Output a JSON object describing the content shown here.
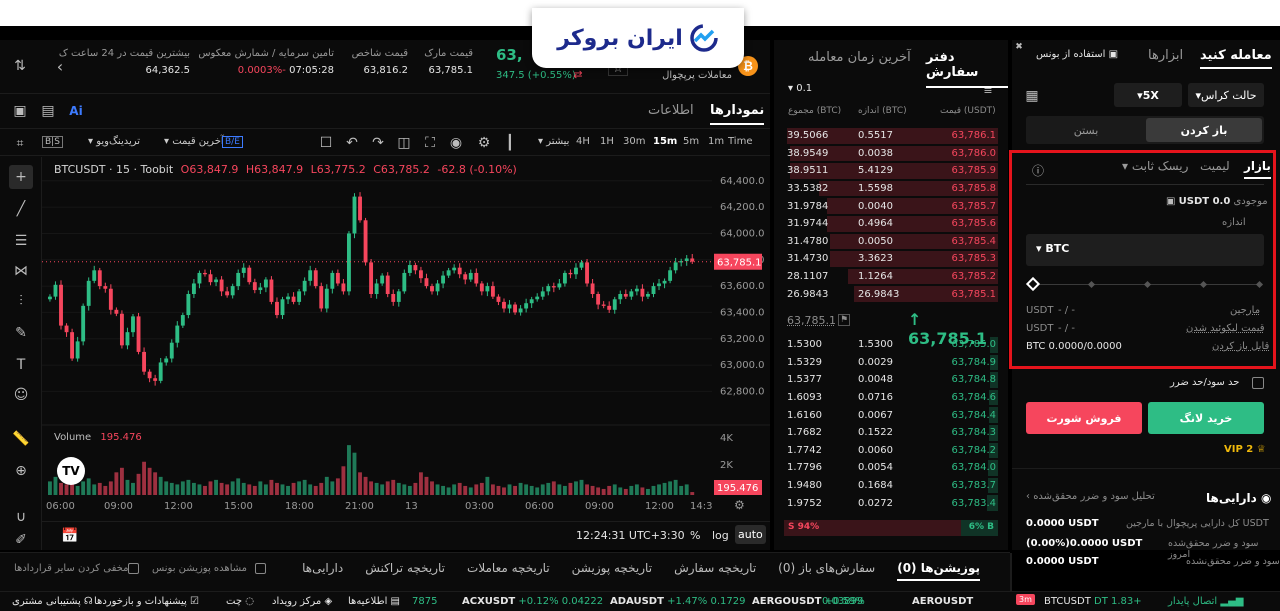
{
  "brand": {
    "logo_text": "ایران بروکر"
  },
  "header": {
    "symbol_price": "63,",
    "symbol_change": "347.5 (+0.55%)",
    "contract_type": "معاملات پرپچوال",
    "stats": [
      {
        "label": "قیمت مارک",
        "value": "63,785.1"
      },
      {
        "label": "قیمت شاخص",
        "value": "63,816.2"
      },
      {
        "label": "تامین سرمایه / شمارش معکوس",
        "value_red": "-0.0003%",
        "value": "07:05:28"
      },
      {
        "label": "بیشترین قیمت در 24 ساعت ک",
        "value": "64,362.5"
      }
    ]
  },
  "chart_tabs": {
    "charts": "نمودارها",
    "info": "اطلاعات"
  },
  "chart_toolbar": {
    "time": "Time",
    "intervals": [
      "1m",
      "5m",
      "15m",
      "30m",
      "1H",
      "4H"
    ],
    "active_interval": "15m",
    "more": "بیشتر",
    "last_price": "آخرین قیمت",
    "tradingview": "تریدینگ‌ویو",
    "be": "B/E",
    "bs": "B|S"
  },
  "chart_legend": {
    "symbol": "BTCUSDT · 15 · Toobit",
    "o": "O63,847.9",
    "h": "H63,847.9",
    "l": "L63,775.2",
    "c": "C63,785.2",
    "chg": "-62.8 (-0.10%)",
    "volume_label": "Volume",
    "volume_value": "195.476"
  },
  "chart_data": {
    "type": "candlestick",
    "symbol": "BTCUSDT",
    "interval": "15m",
    "ylim": [
      62560,
      64520
    ],
    "y_ticks": [
      "64,400.0",
      "64,200.0",
      "64,000.0",
      "63,800.0",
      "63,600.0",
      "63,400.0",
      "63,200.0",
      "63,000.0",
      "62,800.0"
    ],
    "last_price_tag": "63,785.1",
    "x_ticks": [
      "06:00",
      "09:00",
      "12:00",
      "15:00",
      "18:00",
      "21:00",
      "13",
      "03:00",
      "06:00",
      "09:00",
      "12:00",
      "14:3"
    ],
    "volume_ticks": [
      "4K",
      "2K"
    ],
    "volume_tag": "195.476",
    "close_series": [
      63520,
      63610,
      63300,
      63250,
      63050,
      63180,
      63450,
      63640,
      63720,
      63600,
      63580,
      63420,
      63390,
      63150,
      63250,
      63370,
      63100,
      62950,
      62900,
      62880,
      63020,
      63050,
      63170,
      63300,
      63380,
      63540,
      63620,
      63700,
      63690,
      63630,
      63650,
      63560,
      63530,
      63600,
      63700,
      63740,
      63630,
      63570,
      63590,
      63650,
      63480,
      63380,
      63500,
      63520,
      63480,
      63560,
      63640,
      63720,
      63600,
      63430,
      63580,
      63700,
      63620,
      63560,
      64000,
      64280,
      64100,
      63780,
      63540,
      63620,
      63680,
      63540,
      63480,
      63560,
      63700,
      63760,
      63720,
      63660,
      63600,
      63560,
      63620,
      63680,
      63720,
      63740,
      63690,
      63650,
      63700,
      63620,
      63560,
      63600,
      63520,
      63480,
      63430,
      63460,
      63400,
      63430,
      63470,
      63500,
      63520,
      63560,
      63600,
      63590,
      63620,
      63700,
      63690,
      63740,
      63780,
      63620,
      63540,
      63460,
      63450,
      63420,
      63500,
      63540,
      63520,
      63560,
      63580,
      63520,
      63540,
      63600,
      63620,
      63640,
      63720,
      63780,
      63790,
      63810,
      63786
    ],
    "volume_series": [
      900,
      1200,
      800,
      700,
      1000,
      600,
      900,
      1100,
      700,
      800,
      600,
      900,
      1500,
      1800,
      1000,
      800,
      1400,
      2200,
      1800,
      1500,
      1200,
      900,
      800,
      700,
      900,
      1000,
      800,
      700,
      600,
      900,
      1000,
      800,
      700,
      900,
      1100,
      800,
      700,
      600,
      900,
      700,
      1000,
      800,
      700,
      600,
      800,
      900,
      1000,
      700,
      600,
      800,
      1200,
      900,
      1100,
      1900,
      3300,
      2800,
      1500,
      1200,
      900,
      800,
      700,
      900,
      1000,
      800,
      700,
      600,
      800,
      1500,
      1200,
      900,
      700,
      600,
      500,
      700,
      800,
      600,
      500,
      700,
      800,
      1200,
      700,
      600,
      500,
      700,
      600,
      800,
      700,
      600,
      500,
      700,
      800,
      900,
      700,
      600,
      800,
      900,
      1000,
      700,
      600,
      500,
      400,
      600,
      700,
      500,
      400,
      600,
      700,
      500,
      400,
      600,
      700,
      800,
      900,
      1000,
      600,
      700,
      195
    ]
  },
  "chart_footer": {
    "time": "12:24:31 UTC+3:30",
    "pct": "%",
    "log": "log",
    "auto": "auto"
  },
  "orderbook": {
    "tabs": {
      "book": "دفتر سفارش",
      "trades": "آخرین زمان معامله"
    },
    "precision": "0.1",
    "headers": {
      "price": "قیمت (USDT)",
      "size": "اندازه (BTC)",
      "total": "مجموع (BTC)"
    },
    "asks": [
      {
        "price": "63,786.1",
        "size": "0.5517",
        "total": "39.5066"
      },
      {
        "price": "63,786.0",
        "size": "0.0038",
        "total": "38.9549"
      },
      {
        "price": "63,785.9",
        "size": "5.4129",
        "total": "38.9511"
      },
      {
        "price": "63,785.8",
        "size": "1.5598",
        "total": "33.5382"
      },
      {
        "price": "63,785.7",
        "size": "0.0040",
        "total": "31.9784"
      },
      {
        "price": "63,785.6",
        "size": "0.4964",
        "total": "31.9744"
      },
      {
        "price": "63,785.4",
        "size": "0.0050",
        "total": "31.4780"
      },
      {
        "price": "63,785.3",
        "size": "3.3623",
        "total": "31.4730"
      },
      {
        "price": "63,785.2",
        "size": "1.1264",
        "total": "28.1107"
      },
      {
        "price": "63,785.1",
        "size": "26.9843",
        "total": "26.9843"
      }
    ],
    "mid_price": "63,785.1",
    "mark_price": "63,785.1",
    "bids": [
      {
        "price": "63,785.0",
        "size": "1.5300",
        "total": "1.5300"
      },
      {
        "price": "63,784.9",
        "size": "0.0029",
        "total": "1.5329"
      },
      {
        "price": "63,784.8",
        "size": "0.0048",
        "total": "1.5377"
      },
      {
        "price": "63,784.6",
        "size": "0.0716",
        "total": "1.6093"
      },
      {
        "price": "63,784.4",
        "size": "0.0067",
        "total": "1.6160"
      },
      {
        "price": "63,784.3",
        "size": "0.1522",
        "total": "1.7682"
      },
      {
        "price": "63,784.2",
        "size": "0.0060",
        "total": "1.7742"
      },
      {
        "price": "63,784.0",
        "size": "0.0054",
        "total": "1.7796"
      },
      {
        "price": "63,783.7",
        "size": "0.1684",
        "total": "1.9480"
      },
      {
        "price": "63,783.4",
        "size": "0.0272",
        "total": "1.9752"
      }
    ],
    "sell_pct": "S 94%",
    "buy_pct": "6% B"
  },
  "trade_panel": {
    "tabs": {
      "trade": "معامله کنید",
      "tools": "ابزارها",
      "bonus": "استفاده از بونس"
    },
    "mode": "حالت کراس",
    "leverage": "5X",
    "open": "باز کردن",
    "close": "بستن",
    "order_types": {
      "market": "بازار",
      "limit": "لیمیت",
      "fixed_risk": "ریسک ثابت"
    },
    "available_label": "موجودی",
    "available_value": "0.0 USDT",
    "size_label": "اندازه",
    "size_unit": "BTC",
    "margin_label": "مارجین",
    "margin_value": "- / -",
    "margin_unit": "USDT",
    "liq_label": "قیمت لیکوئید شدن",
    "liq_value": "- / -",
    "liq_unit": "USDT",
    "openable_label": "قابل باز کردن",
    "openable_value": "BTC 0.0000/0.0000",
    "tpsl_label": "حد سود/حد ضرر",
    "buy_long": "خرید لانگ",
    "sell_short": "فروش شورت",
    "vip": "VIP 2",
    "assets": {
      "title": "دارایی‌ها",
      "pnl_link": "تحلیل سود و ضرر محقق‌شده",
      "rows": [
        {
          "label": "کل دارایی پرپچوال با مارجین USDT",
          "value": "0.0000 USDT"
        },
        {
          "label": "سود و ضرر محقق‌شده امروز",
          "value": "(0.00%)0.0000 USDT"
        },
        {
          "label": "سود و ضرر محقق‌نشده",
          "value": "0.0000 USDT"
        }
      ]
    }
  },
  "positions": {
    "tabs": [
      "پوزیشن‌ها (0)",
      "سفارش‌های باز (0)",
      "تاریخچه سفارش",
      "تاریخچه پوزیشن",
      "تاریخچه معاملات",
      "تاریخچه تراکنش",
      "دارایی‌ها"
    ],
    "show_bonus": "مشاهده پوزیشن بونس",
    "hide_other": "مخفی کردن سایر قراردادها"
  },
  "ticker": {
    "status": "اتصال پایدار",
    "items": [
      {
        "sym": "BTCUSDT",
        "chg": "",
        "price": "DT 1.83+"
      },
      {
        "sym": "AEROUSDT",
        "chg": "+0.59%",
        "price": "0.03899"
      },
      {
        "sym": "AERGOUSDT",
        "chg": "+0.59%",
        "price": "0.03899"
      },
      {
        "sym": "ADAUSDT",
        "chg": "+1.47%",
        "price": "0.1729"
      },
      {
        "sym": "ACXUSDT",
        "chg": "+0.12%",
        "price": "0.04222"
      },
      {
        "sym": "",
        "chg": "",
        "price": "7875"
      }
    ],
    "links": [
      "اطلاعیه‌ها",
      "مرکز رویداد",
      "چت",
      "پیشنهادات و بازخوردها",
      "پشتیبانی مشتری"
    ]
  }
}
